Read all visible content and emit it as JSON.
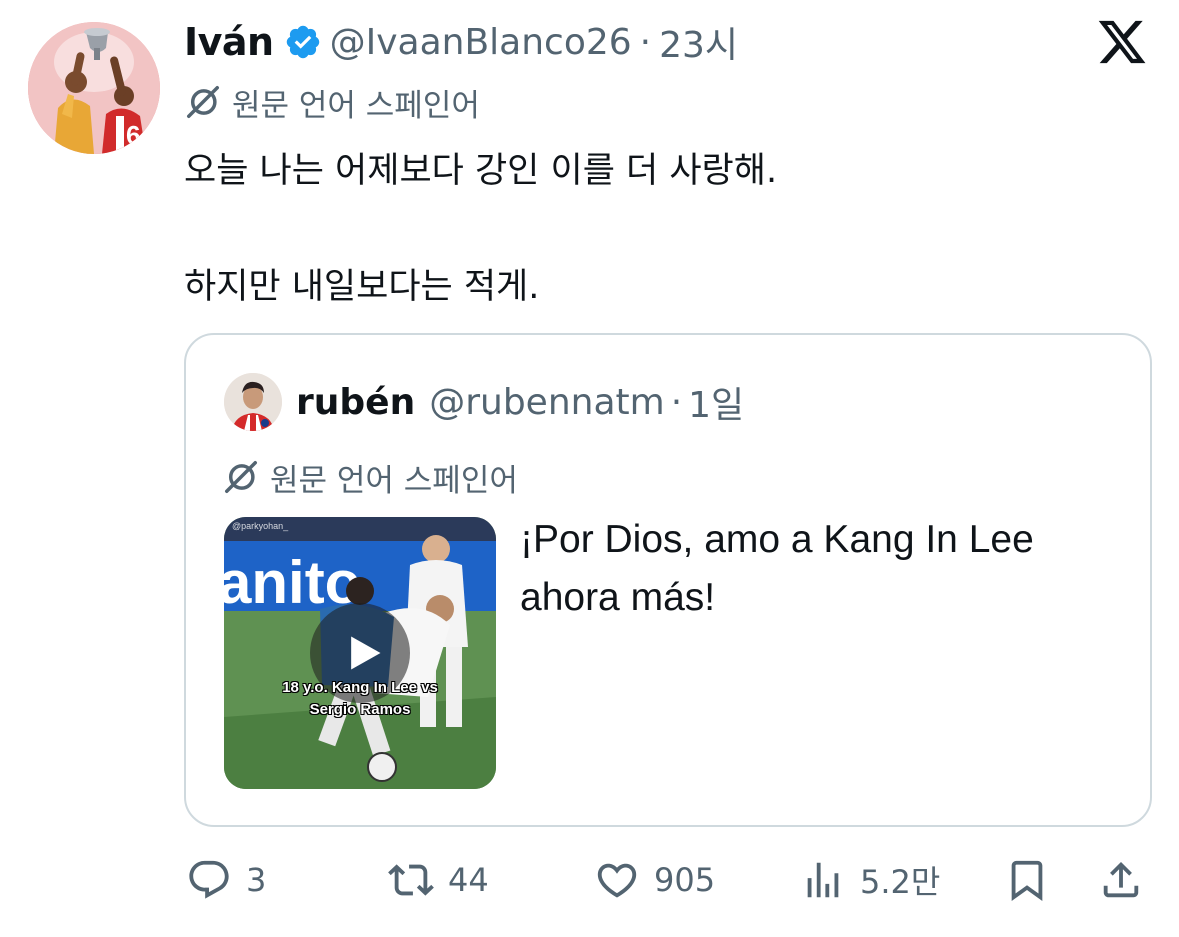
{
  "tweet": {
    "author_name": "Iván",
    "handle": "@IvaanBlanco26",
    "separator": "·",
    "time": "23시",
    "translation_label": "원문 언어 스페인어",
    "lines": [
      "오늘 나는 어제보다 강인 이를 더 사랑해.",
      "하지만 내일보다는 적게."
    ],
    "verified_color": "#1d9bf0"
  },
  "quote": {
    "author_name": "rubén",
    "handle": "@rubennatm",
    "separator": "·",
    "time": "1일",
    "translation_label": "원문 언어 스페인어",
    "text": "¡Por Dios, amo a Kang In Lee ahora más!",
    "video": {
      "caption_line1": "18 y.o. Kang In Lee vs",
      "caption_line2": "Sergio Ramos",
      "watermark": "@parkyohan_",
      "banner_text": "anito"
    }
  },
  "actions": {
    "reply_count": "3",
    "retweet_count": "44",
    "like_count": "905",
    "view_count": "5.2만"
  },
  "icons": [
    "x-logo-icon",
    "verified-badge-icon",
    "translate-icon",
    "play-icon",
    "reply-icon",
    "retweet-icon",
    "like-icon",
    "views-icon",
    "bookmark-icon",
    "share-icon"
  ]
}
